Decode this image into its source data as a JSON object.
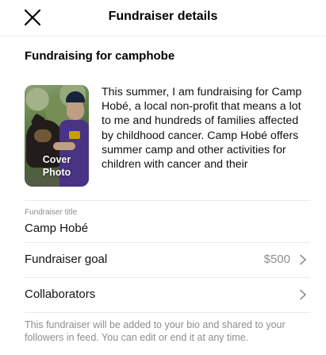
{
  "header": {
    "title": "Fundraiser details",
    "close_icon": "close-icon"
  },
  "section": {
    "title": "Fundraising for camphobe"
  },
  "cover": {
    "label_line1": "Cover",
    "label_line2": "Photo"
  },
  "description": "This summer, I am fundraising for Camp Hobé, a local non-profit that means a lot to me and hundreds of families affected by childhood cancer. Camp Hobé offers summer camp and other activities for children with cancer and their",
  "fundraiser_title": {
    "label": "Fundraiser title",
    "value": "Camp Hobé"
  },
  "goal": {
    "label": "Fundraiser goal",
    "value": "$500",
    "icon": "chevron-right-icon"
  },
  "collaborators": {
    "label": "Collaborators",
    "icon": "chevron-right-icon"
  },
  "footer_note": "This fundraiser will be added to your bio and shared to your followers in feed. You can edit or end it at any time."
}
